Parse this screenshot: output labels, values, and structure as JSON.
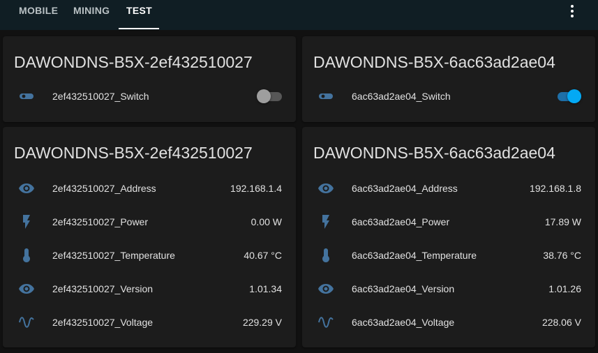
{
  "tabs": [
    {
      "label": "MOBILE",
      "active": false
    },
    {
      "label": "MINING",
      "active": false
    },
    {
      "label": "TEST",
      "active": true
    }
  ],
  "colors": {
    "header_bg": "#101e24",
    "card_bg": "#1c1c1c",
    "icon": "#44739e",
    "toggle_on": "#03a9f4"
  },
  "switch_cards": [
    {
      "title": "DAWONDNS-B5X-2ef432510027",
      "entity": {
        "icon": "toggle-switch-icon",
        "name": "2ef432510027_Switch",
        "state": "off"
      }
    },
    {
      "title": "DAWONDNS-B5X-6ac63ad2ae04",
      "entity": {
        "icon": "toggle-switch-icon",
        "name": "6ac63ad2ae04_Switch",
        "state": "on"
      }
    }
  ],
  "sensor_cards": [
    {
      "title": "DAWONDNS-B5X-2ef432510027",
      "rows": [
        {
          "icon": "eye-icon",
          "name": "2ef432510027_Address",
          "value": "192.168.1.4"
        },
        {
          "icon": "flash-icon",
          "name": "2ef432510027_Power",
          "value": "0.00 W"
        },
        {
          "icon": "thermometer-icon",
          "name": "2ef432510027_Temperature",
          "value": "40.67 °C"
        },
        {
          "icon": "eye-icon",
          "name": "2ef432510027_Version",
          "value": "1.01.34"
        },
        {
          "icon": "sine-wave-icon",
          "name": "2ef432510027_Voltage",
          "value": "229.29 V"
        }
      ]
    },
    {
      "title": "DAWONDNS-B5X-6ac63ad2ae04",
      "rows": [
        {
          "icon": "eye-icon",
          "name": "6ac63ad2ae04_Address",
          "value": "192.168.1.8"
        },
        {
          "icon": "flash-icon",
          "name": "6ac63ad2ae04_Power",
          "value": "17.89 W"
        },
        {
          "icon": "thermometer-icon",
          "name": "6ac63ad2ae04_Temperature",
          "value": "38.76 °C"
        },
        {
          "icon": "eye-icon",
          "name": "6ac63ad2ae04_Version",
          "value": "1.01.26"
        },
        {
          "icon": "sine-wave-icon",
          "name": "6ac63ad2ae04_Voltage",
          "value": "228.06 V"
        }
      ]
    }
  ]
}
